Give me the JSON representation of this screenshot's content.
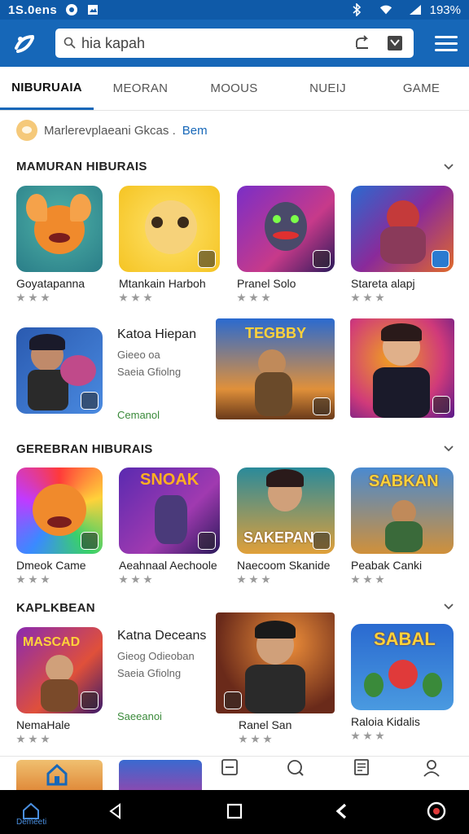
{
  "status": {
    "time": "1S.0ens",
    "battery": "193%"
  },
  "search": {
    "text": "hia kapah"
  },
  "tabs": [
    "NIBURUAIA",
    "MEORAN",
    "MOOUS",
    "NUEIJ",
    "GAME"
  ],
  "notice": {
    "text": "Marlerevplaeani Gkcas .",
    "link": "Bem"
  },
  "sections": [
    {
      "title": "MAMURAN HIBURAIS",
      "apps": [
        "Goyatapanna",
        "Mtankain Harboh",
        "Pranel Solo",
        "Stareta alapj"
      ],
      "feature": {
        "title": "Katoa Hiepan",
        "sub": "Gieeo oa",
        "sub2": "Saeia Gfiolng",
        "link": "Cemanol"
      }
    },
    {
      "title": "GEREBRAN HIBURAIS",
      "apps": [
        "Dmeok Came",
        "Aeahnaal Aechoole",
        "Naecoom Skanide",
        "Peabak Canki"
      ]
    },
    {
      "title": "KAPLKBEAN",
      "apps": [
        "NemaHale",
        "Ranel San",
        "Raloia Kidalis"
      ],
      "feature": {
        "title": "Katna Deceans",
        "sub": "Gieog Odieoban",
        "sub2": "Saeia Gfiolng",
        "link": "Saeeanoi"
      }
    }
  ],
  "thumb_text": {
    "tegbby": "TEGBBY",
    "snoak": "SNOAK",
    "sakepan": "SAKEPAN",
    "sabkan": "SABKAN",
    "mascad": "MASCAD",
    "sabal": "SABAL"
  },
  "bottom_nav": {
    "home_label": "Demeeti"
  },
  "colors": {
    "primary": "#1667b8",
    "status": "#0f5aa8",
    "green": "#3a8a3a"
  }
}
